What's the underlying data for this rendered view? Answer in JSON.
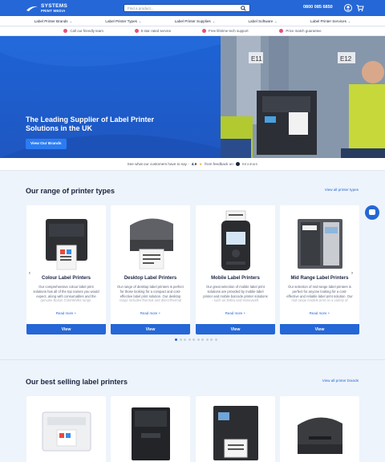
{
  "header": {
    "logo_line1": "SYSTEMS",
    "logo_line2": "PRINT MEDIA",
    "search_placeholder": "Find a product...",
    "phone": "0800 085 6850",
    "icons": [
      "search-icon",
      "user-icon",
      "cart-icon"
    ]
  },
  "nav": [
    {
      "label": "Label Printer Brands"
    },
    {
      "label": "Label Printer Types"
    },
    {
      "label": "Label Printer Supplies"
    },
    {
      "label": "Label Software"
    },
    {
      "label": "Label Printer Services"
    }
  ],
  "usp": [
    {
      "label": "Call our friendly team"
    },
    {
      "label": "5-star rated service"
    },
    {
      "label": "Free lifetime tech support"
    },
    {
      "label": "Price match guarantee"
    }
  ],
  "hero": {
    "title": "The Leading Supplier of Label Printer Solutions in the UK",
    "button": "View Our Brands"
  },
  "trust": {
    "text": "See what our customers have to say -",
    "rating": "4.9",
    "source": "from feedback on",
    "brand": "REVIEWS"
  },
  "range": {
    "title": "Our range of printer types",
    "view_all": "View all printer types",
    "cards": [
      {
        "title": "Colour Label Printers",
        "desc": "Our comprehensive colour label print solutions has all of the top names you would expect, along with consumables and the genuine Epson ColorWorks range.",
        "more": "Read more +",
        "button": "View"
      },
      {
        "title": "Desktop Label Printers",
        "desc": "Our range of desktop label printers is perfect for those looking for a compact and cost-effective label print solution. Our desktop range includes thermal and direct thermal models.",
        "more": "Read more +",
        "button": "View"
      },
      {
        "title": "Mobile Label Printers",
        "desc": "Our great selection of mobile label print solutions are provided by mobile label printer and mobile barcode printer solutions - such as Zebra and Honeywell.",
        "more": "Read more +",
        "button": "View"
      },
      {
        "title": "Mid Range Label Printers",
        "desc": "Our selection of mid-range label printers is perfect for anyone looking for a cost-effective and reliable label print solution. Our mid range models print on a variety of media.",
        "more": "Read more +",
        "button": "View"
      }
    ],
    "pages": 10,
    "active_page": 0
  },
  "bestsellers": {
    "title": "Our best selling label printers",
    "view_all": "View all printer brands"
  },
  "colors": {
    "primary": "#2567d6",
    "dark": "#1b2440",
    "bg": "#eef4fb"
  }
}
